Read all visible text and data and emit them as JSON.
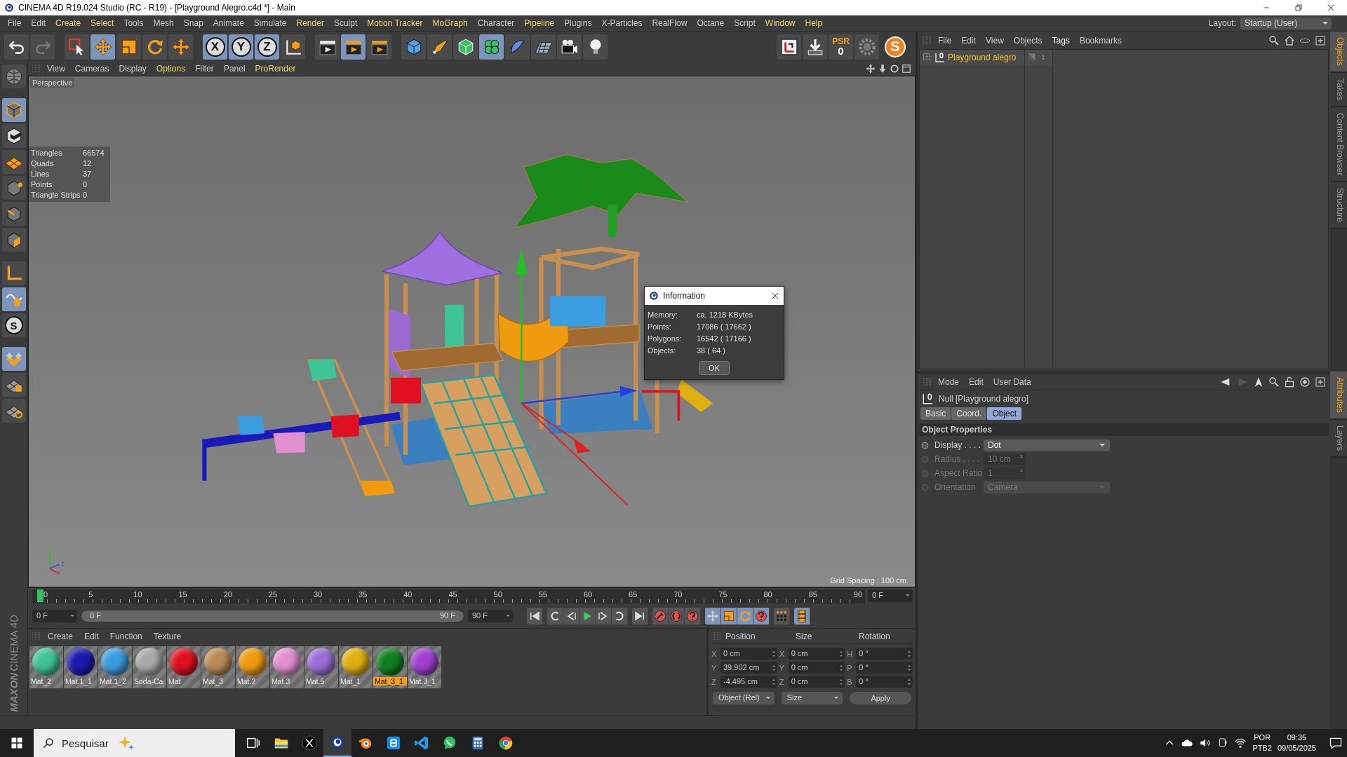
{
  "window": {
    "title": "CINEMA 4D R19.024 Studio (RC - R19) - [Playground Alegro.c4d *] - Main"
  },
  "menu": [
    {
      "label": "File",
      "highlight": false
    },
    {
      "label": "Edit",
      "highlight": false
    },
    {
      "label": "Create",
      "highlight": true
    },
    {
      "label": "Select",
      "highlight": true
    },
    {
      "label": "Tools",
      "highlight": false
    },
    {
      "label": "Mesh",
      "highlight": false
    },
    {
      "label": "Snap",
      "highlight": false
    },
    {
      "label": "Animate",
      "highlight": false
    },
    {
      "label": "Simulate",
      "highlight": false
    },
    {
      "label": "Render",
      "highlight": true
    },
    {
      "label": "Sculpt",
      "highlight": false
    },
    {
      "label": "Motion Tracker",
      "highlight": true
    },
    {
      "label": "MoGraph",
      "highlight": true
    },
    {
      "label": "Character",
      "highlight": false
    },
    {
      "label": "Pipeline",
      "highlight": true
    },
    {
      "label": "Plugins",
      "highlight": false
    },
    {
      "label": "X-Particles",
      "highlight": false
    },
    {
      "label": "RealFlow",
      "highlight": false
    },
    {
      "label": "Octane",
      "highlight": false
    },
    {
      "label": "Script",
      "highlight": false
    },
    {
      "label": "Window",
      "highlight": true
    },
    {
      "label": "Help",
      "highlight": true
    }
  ],
  "layout": {
    "label": "Layout:",
    "value": "Startup (User)"
  },
  "toolbar": {
    "axes": [
      "X",
      "Y",
      "Z"
    ],
    "psr_label": "PSR",
    "psr_value": "0",
    "logo_letter": "S"
  },
  "tool_strip": {
    "snap_letter": "S"
  },
  "viewport": {
    "menu": [
      {
        "label": "View",
        "highlight": false
      },
      {
        "label": "Cameras",
        "highlight": false
      },
      {
        "label": "Display",
        "highlight": false
      },
      {
        "label": "Options",
        "highlight": true
      },
      {
        "label": "Filter",
        "highlight": false
      },
      {
        "label": "Panel",
        "highlight": false
      },
      {
        "label": "ProRender",
        "highlight": true
      }
    ],
    "camera": "Perspective",
    "stats": [
      {
        "label": "Triangles",
        "value": "66574"
      },
      {
        "label": "Quads",
        "value": "12"
      },
      {
        "label": "Lines",
        "value": "37"
      },
      {
        "label": "Points",
        "value": "0"
      },
      {
        "label": "Triangle Strips",
        "value": "0"
      }
    ],
    "grid_spacing": "Grid Spacing : 100 cm",
    "axis_labels": [
      "y",
      "z",
      "x"
    ]
  },
  "dialog": {
    "title": "Information",
    "rows": [
      {
        "label": "Memory:",
        "value": "ca. 1218 KBytes"
      },
      {
        "label": "Points:",
        "value": "17086 ( 17662 )"
      },
      {
        "label": "Polygons:",
        "value": "16542 ( 17166 )"
      },
      {
        "label": "Objects:",
        "value": "38 ( 64 )"
      }
    ],
    "button": "OK"
  },
  "timeline": {
    "ticks": [
      "0",
      "5",
      "10",
      "15",
      "20",
      "25",
      "30",
      "35",
      "40",
      "45",
      "50",
      "55",
      "60",
      "65",
      "70",
      "75",
      "80",
      "85",
      "90"
    ],
    "level": 0,
    "current_frame": "0 F",
    "start_field": "0 F",
    "range": {
      "start": "0 F",
      "end": "90 F",
      "level": 1
    },
    "end_field": "90 F"
  },
  "materials": {
    "menu": [
      "Create",
      "Edit",
      "Function",
      "Texture"
    ],
    "items": [
      {
        "name": "Mat_2",
        "color": "#3fc495",
        "selected": false
      },
      {
        "name": "Mat.1_1",
        "color": "#1a1ab0",
        "selected": false
      },
      {
        "name": "Mat.1_2",
        "color": "#3a9de0",
        "selected": false
      },
      {
        "name": "Soda-Ca",
        "color": "#a8a8a8",
        "selected": false
      },
      {
        "name": "Mat",
        "color": "#e01020",
        "selected": false
      },
      {
        "name": "Mat_3",
        "color": "#b98b55",
        "selected": false
      },
      {
        "name": "Mat.2",
        "color": "#f09a10",
        "selected": false
      },
      {
        "name": "Mat.3",
        "color": "#e090d0",
        "selected": false
      },
      {
        "name": "Mat.5",
        "color": "#9a70d8",
        "selected": false
      },
      {
        "name": "Mat_1",
        "color": "#e0b010",
        "selected": false
      },
      {
        "name": "Mat_3_1",
        "color": "#108020",
        "selected": true
      },
      {
        "name": "Mat.3_1",
        "color": "#a040d0",
        "selected": false
      }
    ]
  },
  "coordinates": {
    "headers": [
      "Position",
      "Size",
      "Rotation"
    ],
    "rows": [
      {
        "axis": "X",
        "position": "0 cm",
        "size_axis": "X",
        "size": "0 cm",
        "rotation_axis": "H",
        "rotation": "0 °"
      },
      {
        "axis": "Y",
        "position": "39.902 cm",
        "size_axis": "Y",
        "size": "0 cm",
        "rotation_axis": "P",
        "rotation": "0 °"
      },
      {
        "axis": "Z",
        "position": "-4.495 cm",
        "size_axis": "Z",
        "size": "0 cm",
        "rotation_axis": "B",
        "rotation": "0 °"
      }
    ],
    "mode": "Object (Rel)",
    "size_mode": "Size",
    "apply": "Apply"
  },
  "brand": {
    "company": "MAXON",
    "product": "CINEMA 4D"
  },
  "objects": {
    "menu": [
      {
        "label": "File",
        "highlight": false
      },
      {
        "label": "Edit",
        "highlight": false
      },
      {
        "label": "View",
        "highlight": false
      },
      {
        "label": "Objects",
        "highlight": false
      },
      {
        "label": "Tags",
        "highlight": true
      },
      {
        "label": "Bookmarks",
        "highlight": false
      }
    ],
    "items": [
      {
        "name": "Playground alegro",
        "selected": true,
        "expanded": false
      }
    ]
  },
  "objects_tabs": [
    {
      "label": "Objects",
      "selected": true
    },
    {
      "label": "Takes",
      "selected": false
    },
    {
      "label": "Content Browser",
      "selected": false
    },
    {
      "label": "Structure",
      "selected": false
    }
  ],
  "attributes": {
    "menu": [
      "Mode",
      "Edit",
      "User Data"
    ],
    "object": "Null [Playground alegro]",
    "tabs": [
      {
        "label": "Basic",
        "selected": false
      },
      {
        "label": "Coord.",
        "selected": false
      },
      {
        "label": "Object",
        "selected": true
      }
    ],
    "section": "Object Properties",
    "fields": [
      {
        "label": "Display . . . .",
        "value": "Dot",
        "kind": "dropdown",
        "disabled": false
      },
      {
        "label": "Radius . . . .",
        "value": "10 cm",
        "kind": "spinner",
        "disabled": true
      },
      {
        "label": "Aspect Ratio",
        "value": "1",
        "kind": "spinner",
        "disabled": true
      },
      {
        "label": "Orientation",
        "value": "Camera",
        "kind": "dropdown",
        "disabled": true
      }
    ]
  },
  "attributes_tabs": [
    {
      "label": "Attributes",
      "selected": true
    },
    {
      "label": "Layers",
      "selected": false
    }
  ],
  "taskbar": {
    "search_placeholder": "Pesquisar",
    "language": "POR",
    "keyboard": "PTB2",
    "time": "09:35",
    "date": "09/05/2025"
  }
}
